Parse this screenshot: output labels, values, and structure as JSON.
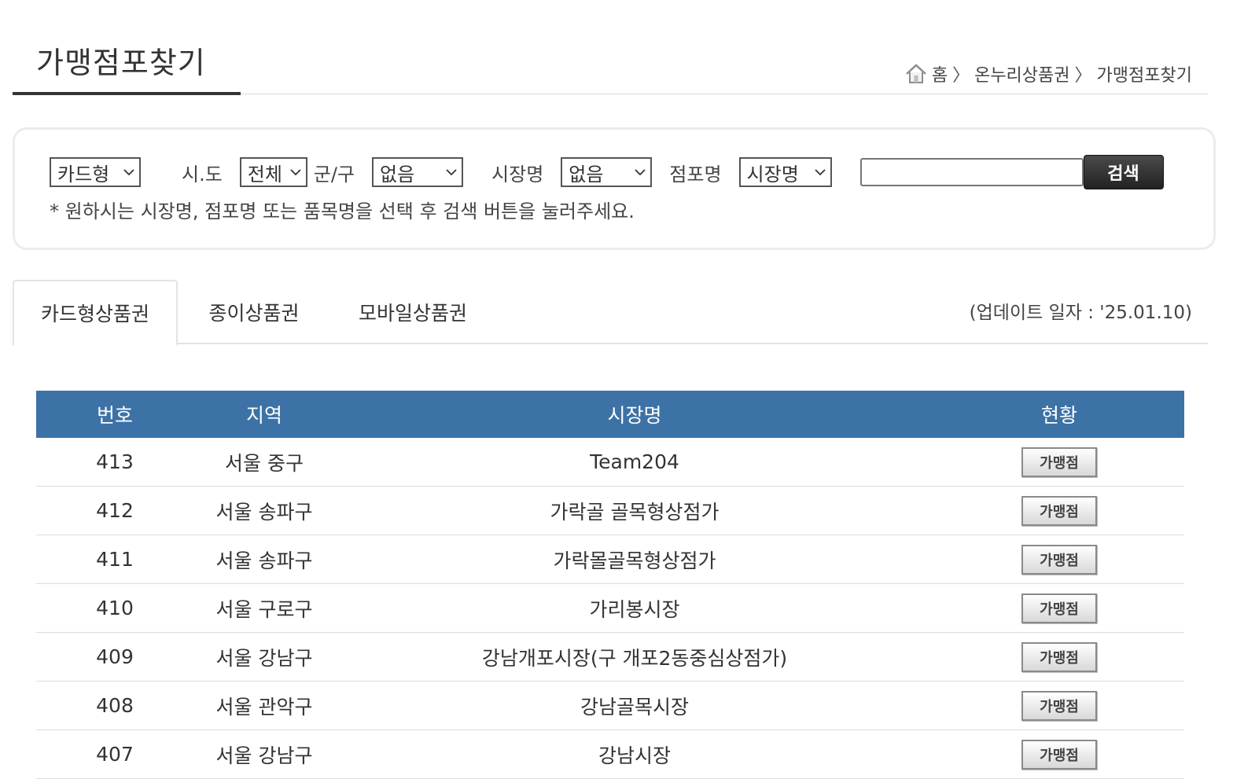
{
  "header": {
    "title": "가맹점포찾기",
    "breadcrumb": [
      "홈",
      "온누리상품권",
      "가맹점포찾기"
    ],
    "breadcrumb_separator": "〉"
  },
  "search": {
    "card_type": "카드형",
    "sido_label": "시.도",
    "sido_value": "전체",
    "gungu_label": "군/구",
    "gungu_value": "없음",
    "market_label": "시장명",
    "market_value": "없음",
    "store_label": "점포명",
    "search_type_value": "시장명",
    "keyword_value": "",
    "button_label": "검색",
    "note": "* 원하시는 시장명, 점포명 또는 품목명을 선택 후 검색 버튼을 눌러주세요."
  },
  "tabs": [
    {
      "label": "카드형상품권",
      "active": true
    },
    {
      "label": "종이상품권",
      "active": false
    },
    {
      "label": "모바일상품권",
      "active": false
    }
  ],
  "update_date": "(업데이트 일자 : '25.01.10)",
  "table": {
    "headers": [
      "번호",
      "지역",
      "시장명",
      "현황"
    ],
    "rows": [
      {
        "num": "413",
        "region": "서울 중구",
        "market": "Team204",
        "status": "가맹점"
      },
      {
        "num": "412",
        "region": "서울 송파구",
        "market": "가락골 골목형상점가",
        "status": "가맹점"
      },
      {
        "num": "411",
        "region": "서울 송파구",
        "market": "가락몰골목형상점가",
        "status": "가맹점"
      },
      {
        "num": "410",
        "region": "서울 구로구",
        "market": "가리봉시장",
        "status": "가맹점"
      },
      {
        "num": "409",
        "region": "서울 강남구",
        "market": "강남개포시장(구 개포2동중심상점가)",
        "status": "가맹점"
      },
      {
        "num": "408",
        "region": "서울 관악구",
        "market": "강남골목시장",
        "status": "가맹점"
      },
      {
        "num": "407",
        "region": "서울 강남구",
        "market": "강남시장",
        "status": "가맹점"
      }
    ]
  },
  "colors": {
    "table_header": "#3c72a6",
    "search_button": "#2b2b2b"
  },
  "icons": {
    "home": "home-icon",
    "select_arrow": "chevron-down-icon"
  }
}
